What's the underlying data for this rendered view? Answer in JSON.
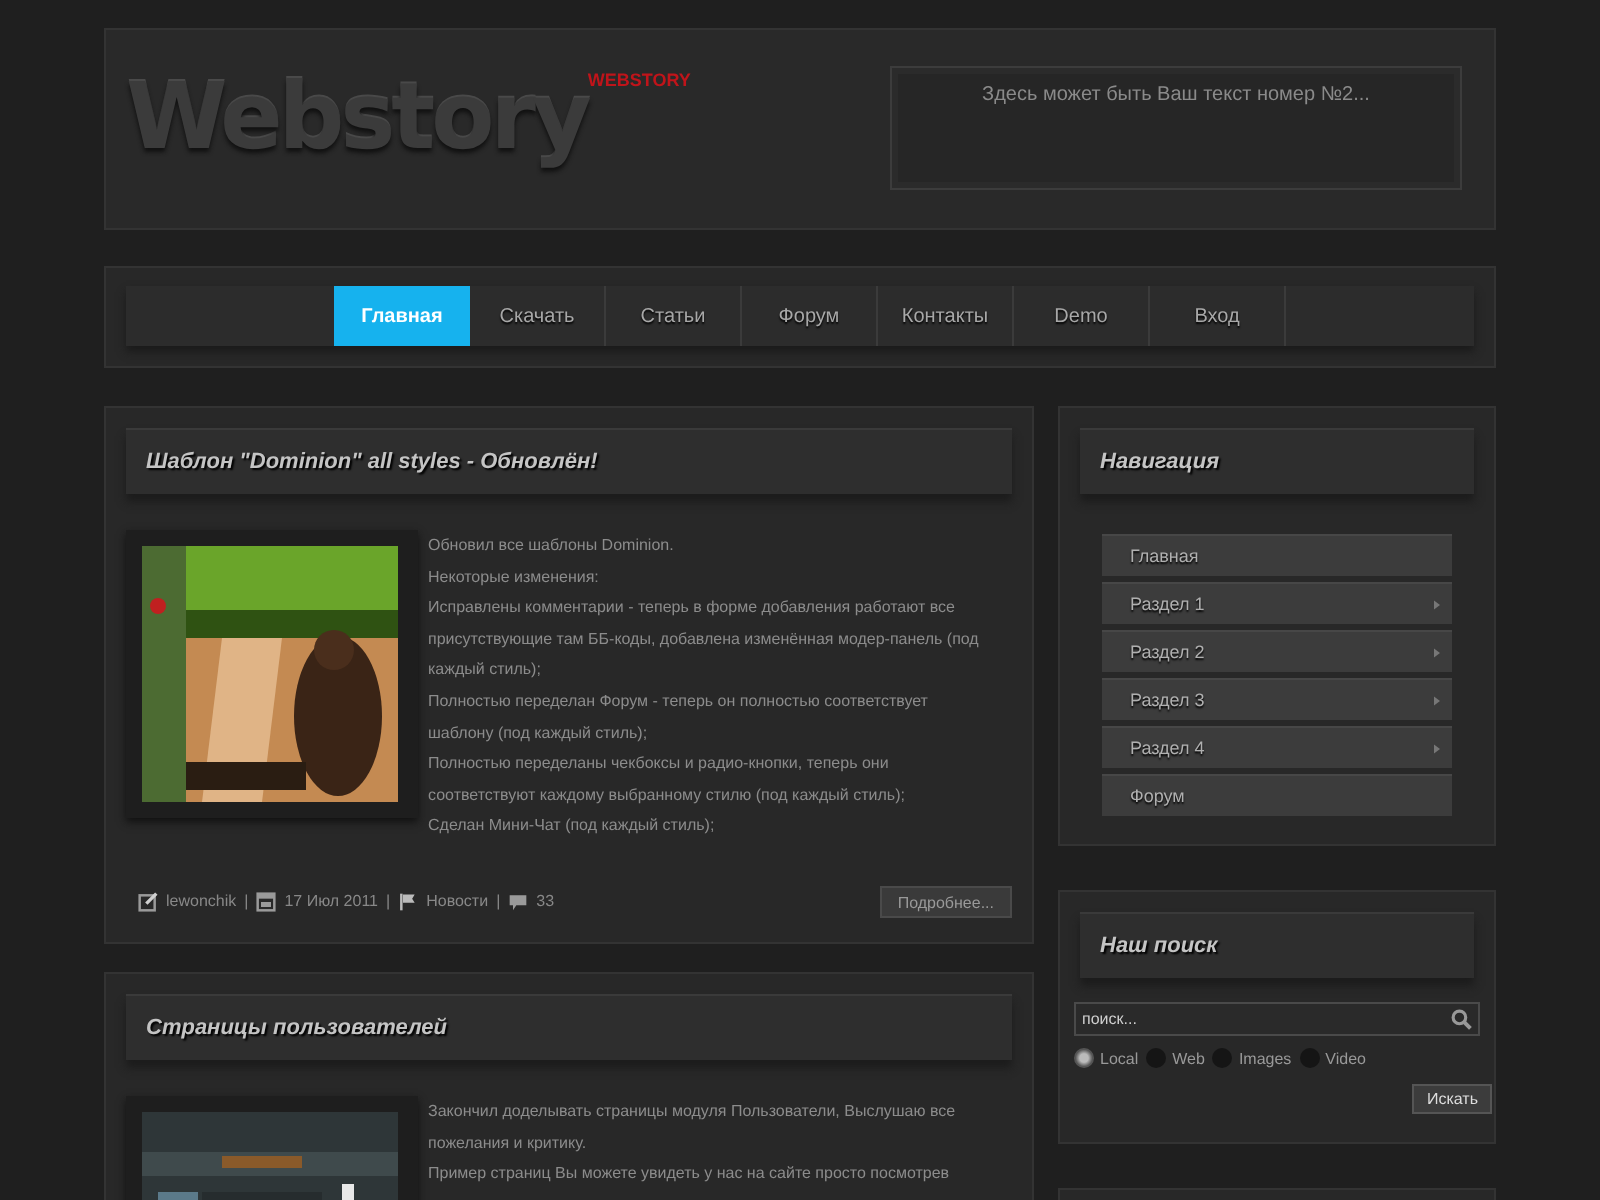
{
  "header": {
    "logo": "Webstory",
    "logo_badge": "WEBSTORY",
    "notice": "Здесь может быть Ваш текст номер №2..."
  },
  "menu": [
    {
      "label": "Главная",
      "selected": true
    },
    {
      "label": "Скачать",
      "selected": false
    },
    {
      "label": "Статьи",
      "selected": false
    },
    {
      "label": "Форум",
      "selected": false
    },
    {
      "label": "Контакты",
      "selected": false
    },
    {
      "label": "Demo",
      "selected": false
    },
    {
      "label": "Вход",
      "selected": false
    }
  ],
  "posts": [
    {
      "title": "Шаблон \"Dominion\" all styles - Обновлён!",
      "image": {
        "kind": "picture"
      },
      "paragraphs": [
        "Обновил все шаблоны Dominion.",
        "Некоторые изменения:",
        "Исправлены комментарии - теперь в форме добавления работают все присутствующие там ББ-коды, добавлена изменённая модер-панель (под каждый стиль);",
        "Полностью переделан Форум - теперь он полностью соответствует шаблону (под каждый стиль);",
        "Полностью переделаны чекбоксы и радио-кнопки, теперь они соответствуют каждому выбранному стилю (под каждый стиль);",
        "Сделан Мини-Чат (под каждый стиль);"
      ],
      "meta": [
        {
          "kind": "author",
          "text": "lewonchik"
        },
        {
          "kind": "separator",
          "text": "|"
        },
        {
          "kind": "date",
          "text": "17 Июл 2011"
        },
        {
          "kind": "separator",
          "text": "|"
        },
        {
          "kind": "category",
          "text": "Новости"
        },
        {
          "kind": "separator",
          "text": "|"
        },
        {
          "kind": "comments",
          "text": "33"
        }
      ],
      "more_button": "Подробнее..."
    },
    {
      "title": "Страницы пользователей",
      "image": {
        "kind": "picture"
      },
      "paragraphs": [
        "Закончил доделывать страницы модуля Пользователи, Выслушаю все пожелания и критику.",
        "Пример страниц Вы можете увидеть у нас на сайте просто посмотрев"
      ]
    }
  ],
  "sidebar": {
    "navigation": {
      "title": "Навигация",
      "items": [
        {
          "label": "Главная",
          "has_submenu": false
        },
        {
          "label": "Раздел 1",
          "has_submenu": true
        },
        {
          "label": "Раздел 2",
          "has_submenu": true
        },
        {
          "label": "Раздел 3",
          "has_submenu": true
        },
        {
          "label": "Раздел 4",
          "has_submenu": true
        },
        {
          "label": "Форум",
          "has_submenu": false
        }
      ]
    },
    "search": {
      "title": "Наш поиск",
      "placeholder": "поиск...",
      "options": [
        {
          "label": "Local",
          "selected": true
        },
        {
          "label": "Web",
          "selected": false
        },
        {
          "label": "Images",
          "selected": false
        },
        {
          "label": "Video",
          "selected": false
        }
      ],
      "button": "Искать"
    }
  }
}
